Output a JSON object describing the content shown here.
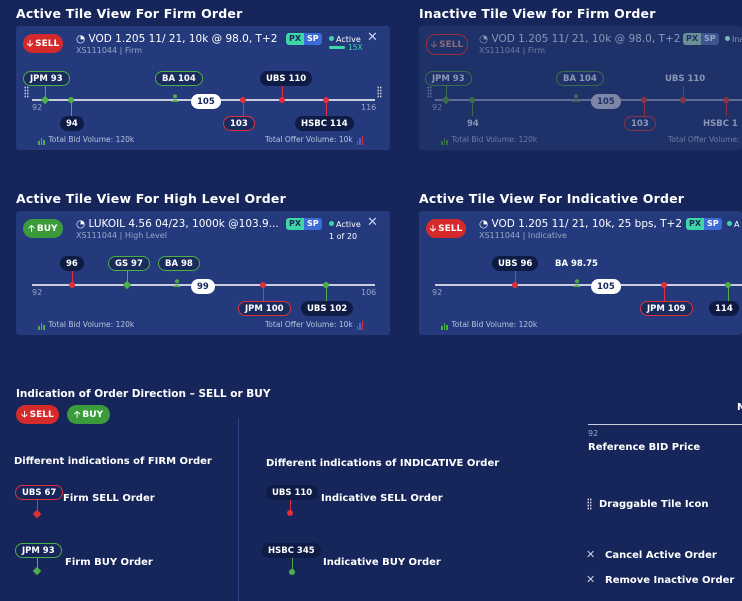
{
  "tiles": [
    {
      "title": "Active Tile View For Firm Order",
      "direction": "SELL",
      "instrument": "VOD 1.205 11/ 21, 10k @ 98.0, T+2",
      "isin": "XS111044 | Firm",
      "px": "PX",
      "sp": "SP",
      "status": "Active",
      "substatus": "15X",
      "tick_min": "92",
      "tick_max": "116",
      "ref": "105",
      "orders": [
        {
          "label": "JPM 93",
          "kind": "fbuy"
        },
        {
          "label": "BA 104",
          "kind": "fbuy"
        },
        {
          "label": "UBS 110",
          "kind": "ind"
        },
        {
          "label": "94",
          "kind": "ind"
        },
        {
          "label": "103",
          "kind": "fsell"
        },
        {
          "label": "HSBC 114",
          "kind": "ind"
        }
      ],
      "bid_volume": "Total Bid Volume: 120k",
      "offer_volume": "Total Offer Volume: 10k"
    },
    {
      "title": "Inactive Tile View for Firm Order",
      "direction": "SELL",
      "instrument": "VOD 1.205 11/ 21, 10k @ 98.0, T+2",
      "isin": "XS111044 | Firm",
      "px": "PX",
      "sp": "SP",
      "status": "Ina",
      "tick_min": "92",
      "ref": "105",
      "orders": [
        {
          "label": "JPM 93"
        },
        {
          "label": "BA 104"
        },
        {
          "label": "UBS 110"
        },
        {
          "label": "94"
        },
        {
          "label": "103"
        },
        {
          "label": "HSBC 1"
        }
      ],
      "bid_volume": "Total Bid Volume: 120k",
      "offer_volume": "Total Offer Volume: 10k"
    },
    {
      "title": "Active Tile View For High Level Order",
      "direction": "BUY",
      "instrument": "LUKOIL 4.56 04/23, 1000k @103.9...",
      "isin": "XS111044 | High Level",
      "px": "PX",
      "sp": "SP",
      "status": "Active",
      "substatus": "1 of 20",
      "tick_min": "92",
      "tick_max": "106",
      "ref": "99",
      "orders": [
        {
          "label": "96"
        },
        {
          "label": "GS 97"
        },
        {
          "label": "BA 98"
        },
        {
          "label": "JPM 100"
        },
        {
          "label": "UBS 102"
        }
      ],
      "bid_volume": "Total Bid Volume: 120k",
      "offer_volume": "Total Offer Volume: 10k"
    },
    {
      "title": "Active Tile View For Indicative Order",
      "direction": "SELL",
      "instrument": "VOD 1.205 11/ 21, 10k, 25 bps, T+2",
      "isin": "XS111044 | Indicative",
      "px": "PX",
      "sp": "SP",
      "status": "A",
      "tick_min": "92",
      "ref": "105",
      "orders": [
        {
          "label": "UBS 96"
        },
        {
          "label": "BA 98.75"
        },
        {
          "label": "JPM 109"
        },
        {
          "label": "114"
        }
      ],
      "bid_volume": "Total Bid Volume: 120k"
    }
  ],
  "legend": {
    "direction_title": "Indication of Order Direction – SELL or BUY",
    "sell": "SELL",
    "buy": "BUY",
    "firm_title": "Different indications of FIRM Order",
    "firm_sell_tag": "UBS 67",
    "firm_sell_label": "Firm SELL Order",
    "firm_buy_tag": "JPM 93",
    "firm_buy_label": "Firm BUY Order",
    "ind_title": "Different indications of INDICATIVE Order",
    "ind_sell_tag": "UBS 110",
    "ind_sell_label": "Indicative SELL Order",
    "ind_buy_tag": "HSBC 345",
    "ind_buy_label": "Indicative BUY Order",
    "ref_tick": "92",
    "ref_label": "Reference BID Price",
    "cut_letter": "N",
    "drag_label": "Draggable Tile Icon",
    "cancel_label": "Cancel Active Order",
    "remove_label": "Remove Inactive Order"
  },
  "colors": {
    "background": "#16265a",
    "tile": "#243a7c",
    "sell": "#e0303a",
    "buy": "#4caf48",
    "px": "#3fd6a6",
    "sp": "#3a6bd6"
  }
}
